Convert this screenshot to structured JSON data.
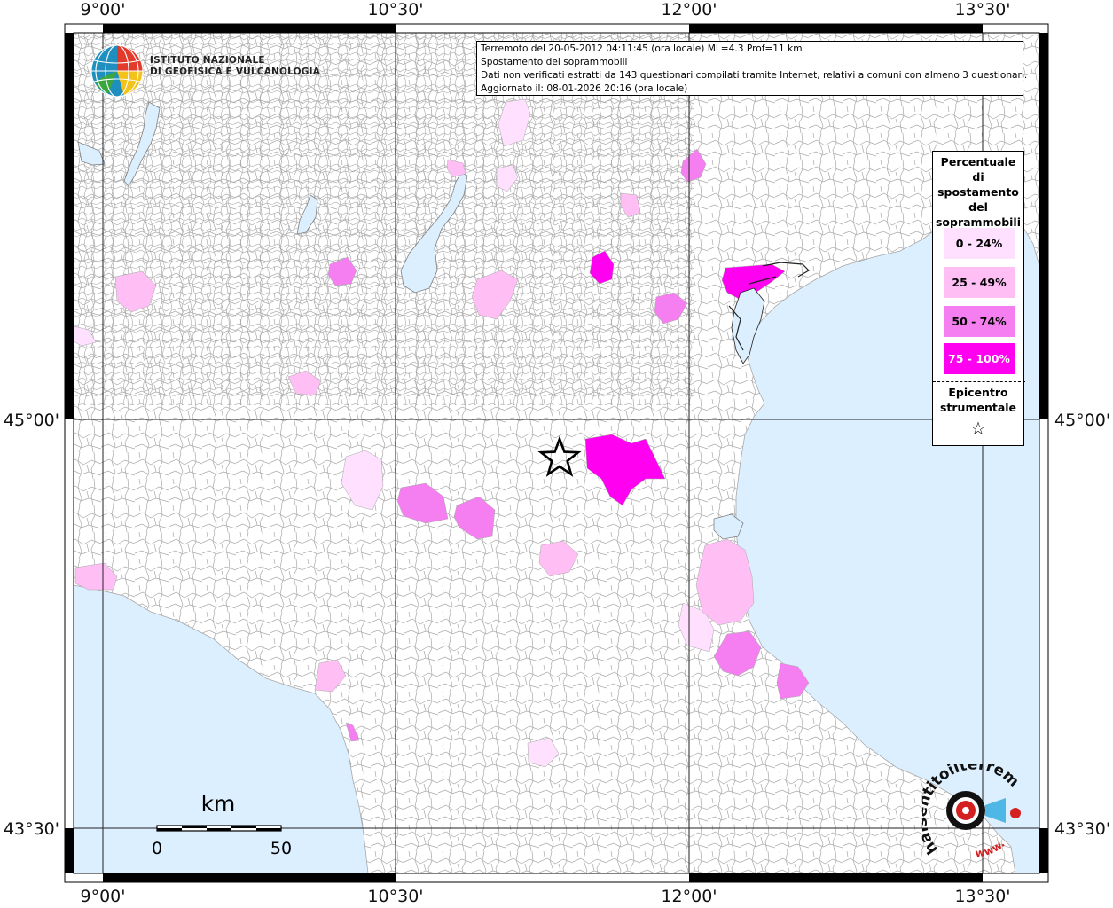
{
  "info": {
    "line1": "Terremoto del 20-05-2012 04:11:45 (ora locale) ML=4.3 Prof=11 km",
    "line2": "Spostamento dei soprammobili",
    "line3": "Dati non verificati estratti da 143 questionari compilati tramite Internet, relativi a comuni con almeno 3 questionari.",
    "line4": "Aggiornato il: 08-01-2026 20:16 (ora locale)"
  },
  "institute": {
    "line1": "ISTITUTO NAZIONALE",
    "line2": "DI GEOFISICA E VULCANOLOGIA"
  },
  "axes": {
    "x_top": [
      "9°00'",
      "10°30'",
      "12°00'",
      "13°30'"
    ],
    "x_bottom": [
      "9°00'",
      "10°30'",
      "12°00'",
      "13°30'"
    ],
    "y_left": [
      "45°00'",
      "43°30'"
    ],
    "y_right": [
      "45°00'",
      "43°30'"
    ]
  },
  "legend": {
    "title_lines": [
      "Percentuale",
      "di",
      "spostamento",
      "del",
      "soprammobili"
    ],
    "items": [
      {
        "label": "0 - 24%",
        "color": "#ffe0ff"
      },
      {
        "label": "25 - 49%",
        "color": "#ffbff5"
      },
      {
        "label": "50 - 74%",
        "color": "#f57ff0"
      },
      {
        "label": "75 - 100%",
        "color": "#ff00f0"
      }
    ],
    "epicenter_lines": [
      "Epicentro",
      "strumentale"
    ],
    "epicenter_symbol": "☆"
  },
  "scale": {
    "unit": "km",
    "start": "0",
    "end": "50"
  },
  "logo_text": {
    "site": "haisentitoilterremoto.it",
    "prefix": "www."
  },
  "colors": {
    "sea": "#dcefff",
    "land": "#ffffff",
    "border": "#a8a8a8"
  }
}
